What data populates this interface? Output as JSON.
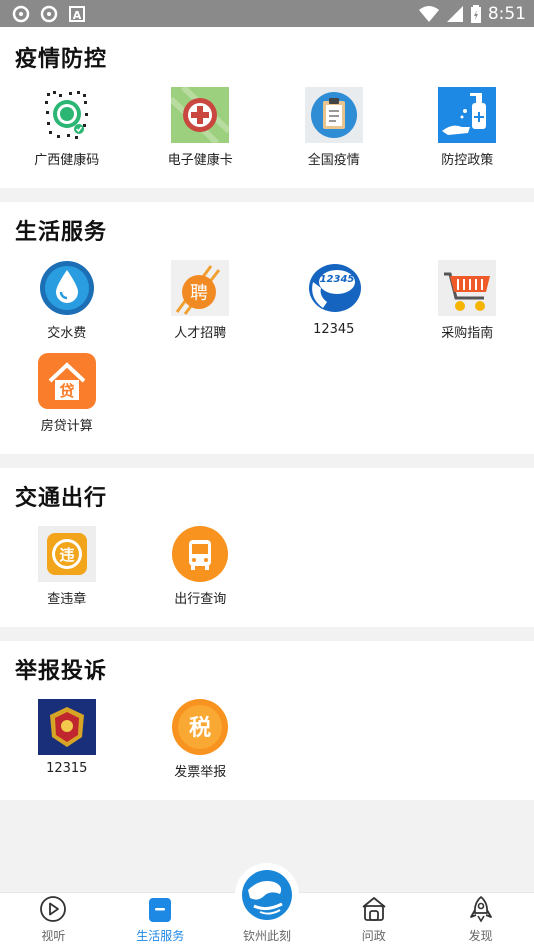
{
  "status_bar": {
    "time": "8:51"
  },
  "sections": [
    {
      "title": "疫情防控",
      "items": [
        {
          "label": "广西健康码",
          "icon": "qr-code-icon"
        },
        {
          "label": "电子健康卡",
          "icon": "health-card-icon"
        },
        {
          "label": "全国疫情",
          "icon": "clipboard-icon"
        },
        {
          "label": "防控政策",
          "icon": "hand-sanitizer-icon"
        }
      ]
    },
    {
      "title": "生活服务",
      "items": [
        {
          "label": "交水费",
          "icon": "water-drop-icon"
        },
        {
          "label": "人才招聘",
          "icon": "recruit-icon"
        },
        {
          "label": "12345",
          "icon": "hotline-icon"
        },
        {
          "label": "采购指南",
          "icon": "shopping-cart-icon"
        },
        {
          "label": "房贷计算",
          "icon": "loan-house-icon"
        }
      ]
    },
    {
      "title": "交通出行",
      "items": [
        {
          "label": "查违章",
          "icon": "violation-icon"
        },
        {
          "label": "出行查询",
          "icon": "bus-icon"
        }
      ]
    },
    {
      "title": "举报投诉",
      "items": [
        {
          "label": "12315",
          "icon": "emblem-icon"
        },
        {
          "label": "发票举报",
          "icon": "tax-icon"
        }
      ]
    }
  ],
  "tabbar": {
    "tabs": [
      {
        "label": "视听",
        "icon": "play-icon"
      },
      {
        "label": "生活服务",
        "icon": "life-service-icon"
      },
      {
        "label": "钦州此刻",
        "icon": "globe-logo-icon"
      },
      {
        "label": "问政",
        "icon": "government-icon"
      },
      {
        "label": "发现",
        "icon": "rocket-icon"
      }
    ],
    "active_color": "#1e88e5"
  }
}
